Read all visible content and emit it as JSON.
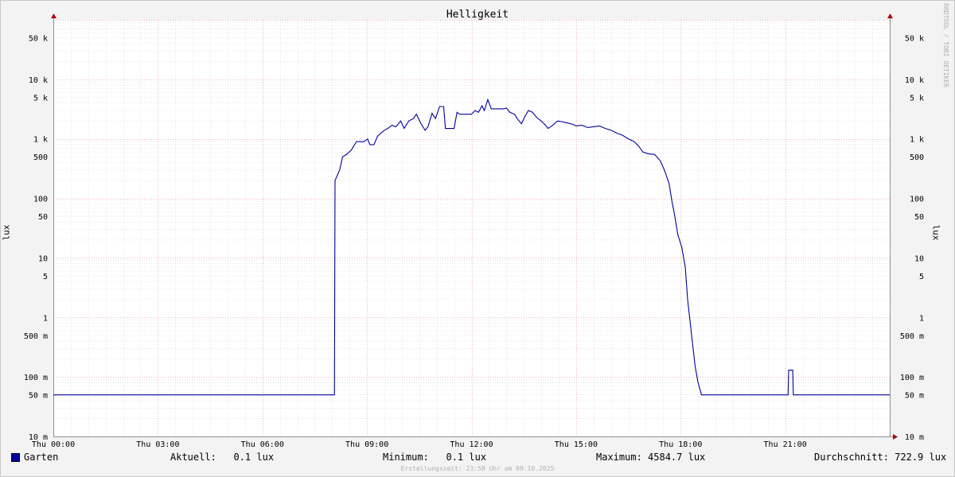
{
  "chart_data": {
    "type": "line",
    "title": "Helligkeit",
    "ylabel": "lux",
    "y_scale": "log",
    "ylim": [
      0.01,
      100000
    ],
    "y_ticks": [
      {
        "value": 0.01,
        "label": "10 m"
      },
      {
        "value": 0.05,
        "label": "50 m"
      },
      {
        "value": 0.1,
        "label": "100 m"
      },
      {
        "value": 0.5,
        "label": "500 m"
      },
      {
        "value": 1,
        "label": "1"
      },
      {
        "value": 5,
        "label": "5"
      },
      {
        "value": 10,
        "label": "10"
      },
      {
        "value": 50,
        "label": "50"
      },
      {
        "value": 100,
        "label": "100"
      },
      {
        "value": 500,
        "label": "500"
      },
      {
        "value": 1000,
        "label": "1 k"
      },
      {
        "value": 5000,
        "label": "5 k"
      },
      {
        "value": 10000,
        "label": "10 k"
      },
      {
        "value": 50000,
        "label": "50 k"
      }
    ],
    "xlim": [
      "00:00",
      "24:00"
    ],
    "x_ticks": [
      "Thu 00:00",
      "Thu 03:00",
      "Thu 06:00",
      "Thu 09:00",
      "Thu 12:00",
      "Thu 15:00",
      "Thu 18:00",
      "Thu 21:00"
    ],
    "grid": true,
    "series": [
      {
        "name": "Garten",
        "color": "#00009c",
        "points": [
          [
            "00:00",
            0.05
          ],
          [
            "08:04",
            0.05
          ],
          [
            "08:05",
            200
          ],
          [
            "08:13",
            300
          ],
          [
            "08:18",
            500
          ],
          [
            "08:25",
            550
          ],
          [
            "08:33",
            650
          ],
          [
            "08:42",
            900
          ],
          [
            "08:55",
            900
          ],
          [
            "09:01",
            1000
          ],
          [
            "09:05",
            800
          ],
          [
            "09:12",
            800
          ],
          [
            "09:18",
            1100
          ],
          [
            "09:24",
            1250
          ],
          [
            "09:30",
            1400
          ],
          [
            "09:36",
            1500
          ],
          [
            "09:43",
            1700
          ],
          [
            "09:50",
            1600
          ],
          [
            "09:58",
            2000
          ],
          [
            "10:04",
            1500
          ],
          [
            "10:12",
            2000
          ],
          [
            "10:20",
            2200
          ],
          [
            "10:25",
            2600
          ],
          [
            "10:33",
            1800
          ],
          [
            "10:40",
            1400
          ],
          [
            "10:45",
            1600
          ],
          [
            "10:52",
            2700
          ],
          [
            "10:58",
            2200
          ],
          [
            "11:05",
            3500
          ],
          [
            "11:12",
            3500
          ],
          [
            "11:15",
            1500
          ],
          [
            "11:30",
            1500
          ],
          [
            "11:35",
            2800
          ],
          [
            "11:40",
            2600
          ],
          [
            "12:00",
            2600
          ],
          [
            "12:06",
            3000
          ],
          [
            "12:12",
            2800
          ],
          [
            "12:18",
            3600
          ],
          [
            "12:22",
            3000
          ],
          [
            "12:28",
            4580
          ],
          [
            "12:34",
            3200
          ],
          [
            "12:45",
            3200
          ],
          [
            "12:55",
            3200
          ],
          [
            "13:00",
            3300
          ],
          [
            "13:06",
            2800
          ],
          [
            "13:14",
            2600
          ],
          [
            "13:20",
            2100
          ],
          [
            "13:26",
            1800
          ],
          [
            "13:32",
            2400
          ],
          [
            "13:38",
            3000
          ],
          [
            "13:45",
            2800
          ],
          [
            "13:52",
            2300
          ],
          [
            "14:00",
            2000
          ],
          [
            "14:05",
            1800
          ],
          [
            "14:12",
            1500
          ],
          [
            "14:20",
            1700
          ],
          [
            "14:28",
            2000
          ],
          [
            "14:35",
            1950
          ],
          [
            "14:45",
            1850
          ],
          [
            "14:55",
            1750
          ],
          [
            "15:00",
            1650
          ],
          [
            "15:10",
            1700
          ],
          [
            "15:20",
            1550
          ],
          [
            "15:30",
            1600
          ],
          [
            "15:40",
            1650
          ],
          [
            "15:50",
            1500
          ],
          [
            "16:00",
            1400
          ],
          [
            "16:10",
            1250
          ],
          [
            "16:20",
            1150
          ],
          [
            "16:30",
            1000
          ],
          [
            "16:40",
            900
          ],
          [
            "16:48",
            750
          ],
          [
            "16:55",
            600
          ],
          [
            "17:05",
            560
          ],
          [
            "17:15",
            550
          ],
          [
            "17:25",
            430
          ],
          [
            "17:32",
            300
          ],
          [
            "17:40",
            180
          ],
          [
            "17:45",
            90
          ],
          [
            "17:50",
            50
          ],
          [
            "17:55",
            25
          ],
          [
            "18:02",
            15
          ],
          [
            "18:08",
            7
          ],
          [
            "18:12",
            2
          ],
          [
            "18:16",
            0.9
          ],
          [
            "18:20",
            0.4
          ],
          [
            "18:25",
            0.15
          ],
          [
            "18:30",
            0.08
          ],
          [
            "18:36",
            0.05
          ],
          [
            "21:05",
            0.05
          ],
          [
            "21:06",
            0.13
          ],
          [
            "21:13",
            0.13
          ],
          [
            "21:14",
            0.05
          ],
          [
            "24:00",
            0.05
          ]
        ]
      }
    ],
    "legend": [
      {
        "name": "Garten",
        "color": "#00009c"
      }
    ]
  },
  "legend": {
    "series_name": "Garten",
    "current": "Aktuell:   0.1 lux",
    "minimum": "Minimum:   0.1 lux",
    "maximum": "Maximum: 4584.7 lux",
    "average": "Durchschnitt: 722.9 lux"
  },
  "footer": "Erstellungszeit: 23:58 Uhr am 09.10.2025",
  "watermark": "RRDTOOL / TOBI OETIKER"
}
